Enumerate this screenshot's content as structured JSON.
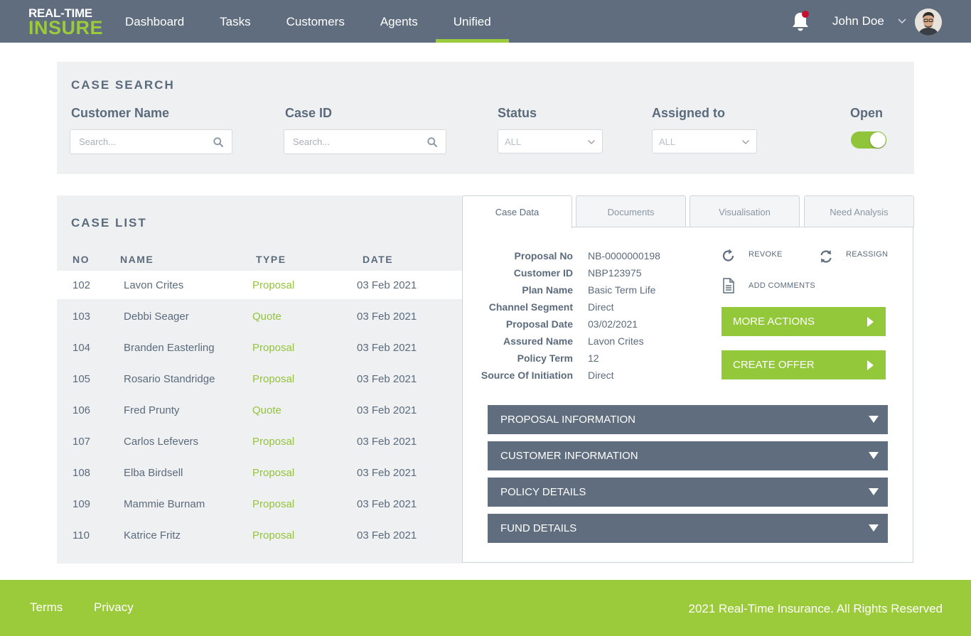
{
  "logo": {
    "line1": "REAL-TIME",
    "line2": "INSURE"
  },
  "nav": [
    {
      "label": "Dashboard",
      "active": false
    },
    {
      "label": "Tasks",
      "active": false
    },
    {
      "label": "Customers",
      "active": false
    },
    {
      "label": "Agents",
      "active": false
    },
    {
      "label": "Unified",
      "active": true
    }
  ],
  "user": {
    "name": "John Doe",
    "has_notification": true
  },
  "case_search": {
    "title": "CASE SEARCH",
    "customer_name_label": "Customer Name",
    "customer_name_placeholder": "Search...",
    "case_id_label": "Case ID",
    "case_id_placeholder": "Search...",
    "status_label": "Status",
    "status_value": "ALL",
    "assigned_label": "Assigned to",
    "assigned_value": "ALL",
    "open_label": "Open",
    "open_on": true
  },
  "case_list": {
    "title": "CASE LIST",
    "columns": [
      "NO",
      "NAME",
      "TYPE",
      "DATE"
    ],
    "rows": [
      {
        "no": "102",
        "name": "Lavon Crites",
        "type": "Proposal",
        "date": "03 Feb 2021",
        "selected": true
      },
      {
        "no": "103",
        "name": "Debbi Seager",
        "type": "Quote",
        "date": "03 Feb 2021"
      },
      {
        "no": "104",
        "name": "Branden Easterling",
        "type": "Proposal",
        "date": "03 Feb 2021"
      },
      {
        "no": "105",
        "name": "Rosario Standridge",
        "type": "Proposal",
        "date": "03 Feb 2021"
      },
      {
        "no": "106",
        "name": "Fred Prunty",
        "type": "Quote",
        "date": "03 Feb 2021"
      },
      {
        "no": "107",
        "name": "Carlos Lefevers",
        "type": "Proposal",
        "date": "03 Feb 2021"
      },
      {
        "no": "108",
        "name": "Elba Birdsell",
        "type": "Proposal",
        "date": "03 Feb 2021"
      },
      {
        "no": "109",
        "name": "Mammie Burnam",
        "type": "Proposal",
        "date": "03 Feb 2021"
      },
      {
        "no": "110",
        "name": "Katrice Fritz",
        "type": "Proposal",
        "date": "03 Feb 2021"
      }
    ]
  },
  "tabs": [
    {
      "label": "Case Data",
      "active": true
    },
    {
      "label": "Documents",
      "active": false
    },
    {
      "label": "Visualisation",
      "active": false
    },
    {
      "label": "Need Analysis",
      "active": false
    }
  ],
  "case_data": {
    "fields": [
      {
        "key": "Proposal No",
        "value": "NB-0000000198"
      },
      {
        "key": "Customer ID",
        "value": "NBP123975"
      },
      {
        "key": "Plan Name",
        "value": "Basic Term Life"
      },
      {
        "key": "Channel Segment",
        "value": "Direct"
      },
      {
        "key": "Proposal Date",
        "value": "03/02/2021"
      },
      {
        "key": "Assured Name",
        "value": "Lavon Crites"
      },
      {
        "key": "Policy Term",
        "value": "12"
      },
      {
        "key": "Source Of Initiation",
        "value": "Direct"
      }
    ],
    "actions": {
      "revoke": "REVOKE",
      "reassign": "REASSIGN",
      "add_comments": "ADD COMMENTS"
    },
    "more_actions": "MORE ACTIONS",
    "create_offer": "CREATE OFFER",
    "sections": [
      "PROPOSAL INFORMATION",
      "CUSTOMER INFORMATION",
      "POLICY DETAILS",
      "FUND DETAILS"
    ]
  },
  "footer": {
    "terms": "Terms",
    "privacy": "Privacy",
    "copyright": "2021 Real-Time Insurance. All Rights Reserved"
  },
  "colors": {
    "header": "#5f6d7e",
    "accent": "#9bcb3a",
    "notification": "#c8102e"
  }
}
